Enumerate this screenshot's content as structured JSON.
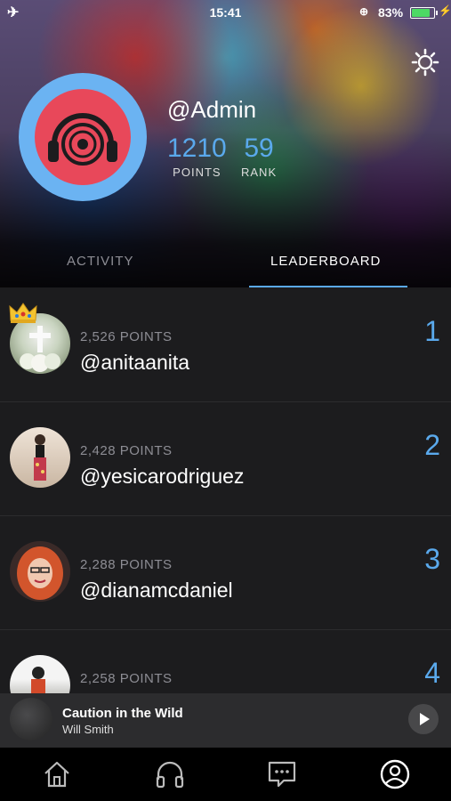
{
  "status_bar": {
    "time": "15:41",
    "battery": "83%",
    "airplane_icon": "airplane-icon",
    "battery_level": 0.83
  },
  "profile": {
    "username": "@Admin",
    "points_value": "1210",
    "points_label": "POINTS",
    "rank_value": "59",
    "rank_label": "RANK"
  },
  "tabs": [
    {
      "label": "ACTIVITY",
      "active": false
    },
    {
      "label": "LEADERBOARD",
      "active": true
    }
  ],
  "leaderboard": [
    {
      "points": "2,526 POINTS",
      "handle": "@anitaanita",
      "rank": "1",
      "crown": true
    },
    {
      "points": "2,428 POINTS",
      "handle": "@yesicarodriguez",
      "rank": "2"
    },
    {
      "points": "2,288 POINTS",
      "handle": "@dianamcdaniel",
      "rank": "3"
    },
    {
      "points": "2,258 POINTS",
      "handle": "",
      "rank": "4"
    }
  ],
  "now_playing": {
    "title": "Caution in the Wild",
    "artist": "Will Smith"
  },
  "nav": [
    "home-icon",
    "headphones-icon",
    "chat-icon",
    "profile-icon"
  ],
  "colors": {
    "accent": "#5aa9ec",
    "avatar_bg": "#6bb3f2",
    "logo_red": "#e8485a",
    "background": "#1c1c1e"
  }
}
